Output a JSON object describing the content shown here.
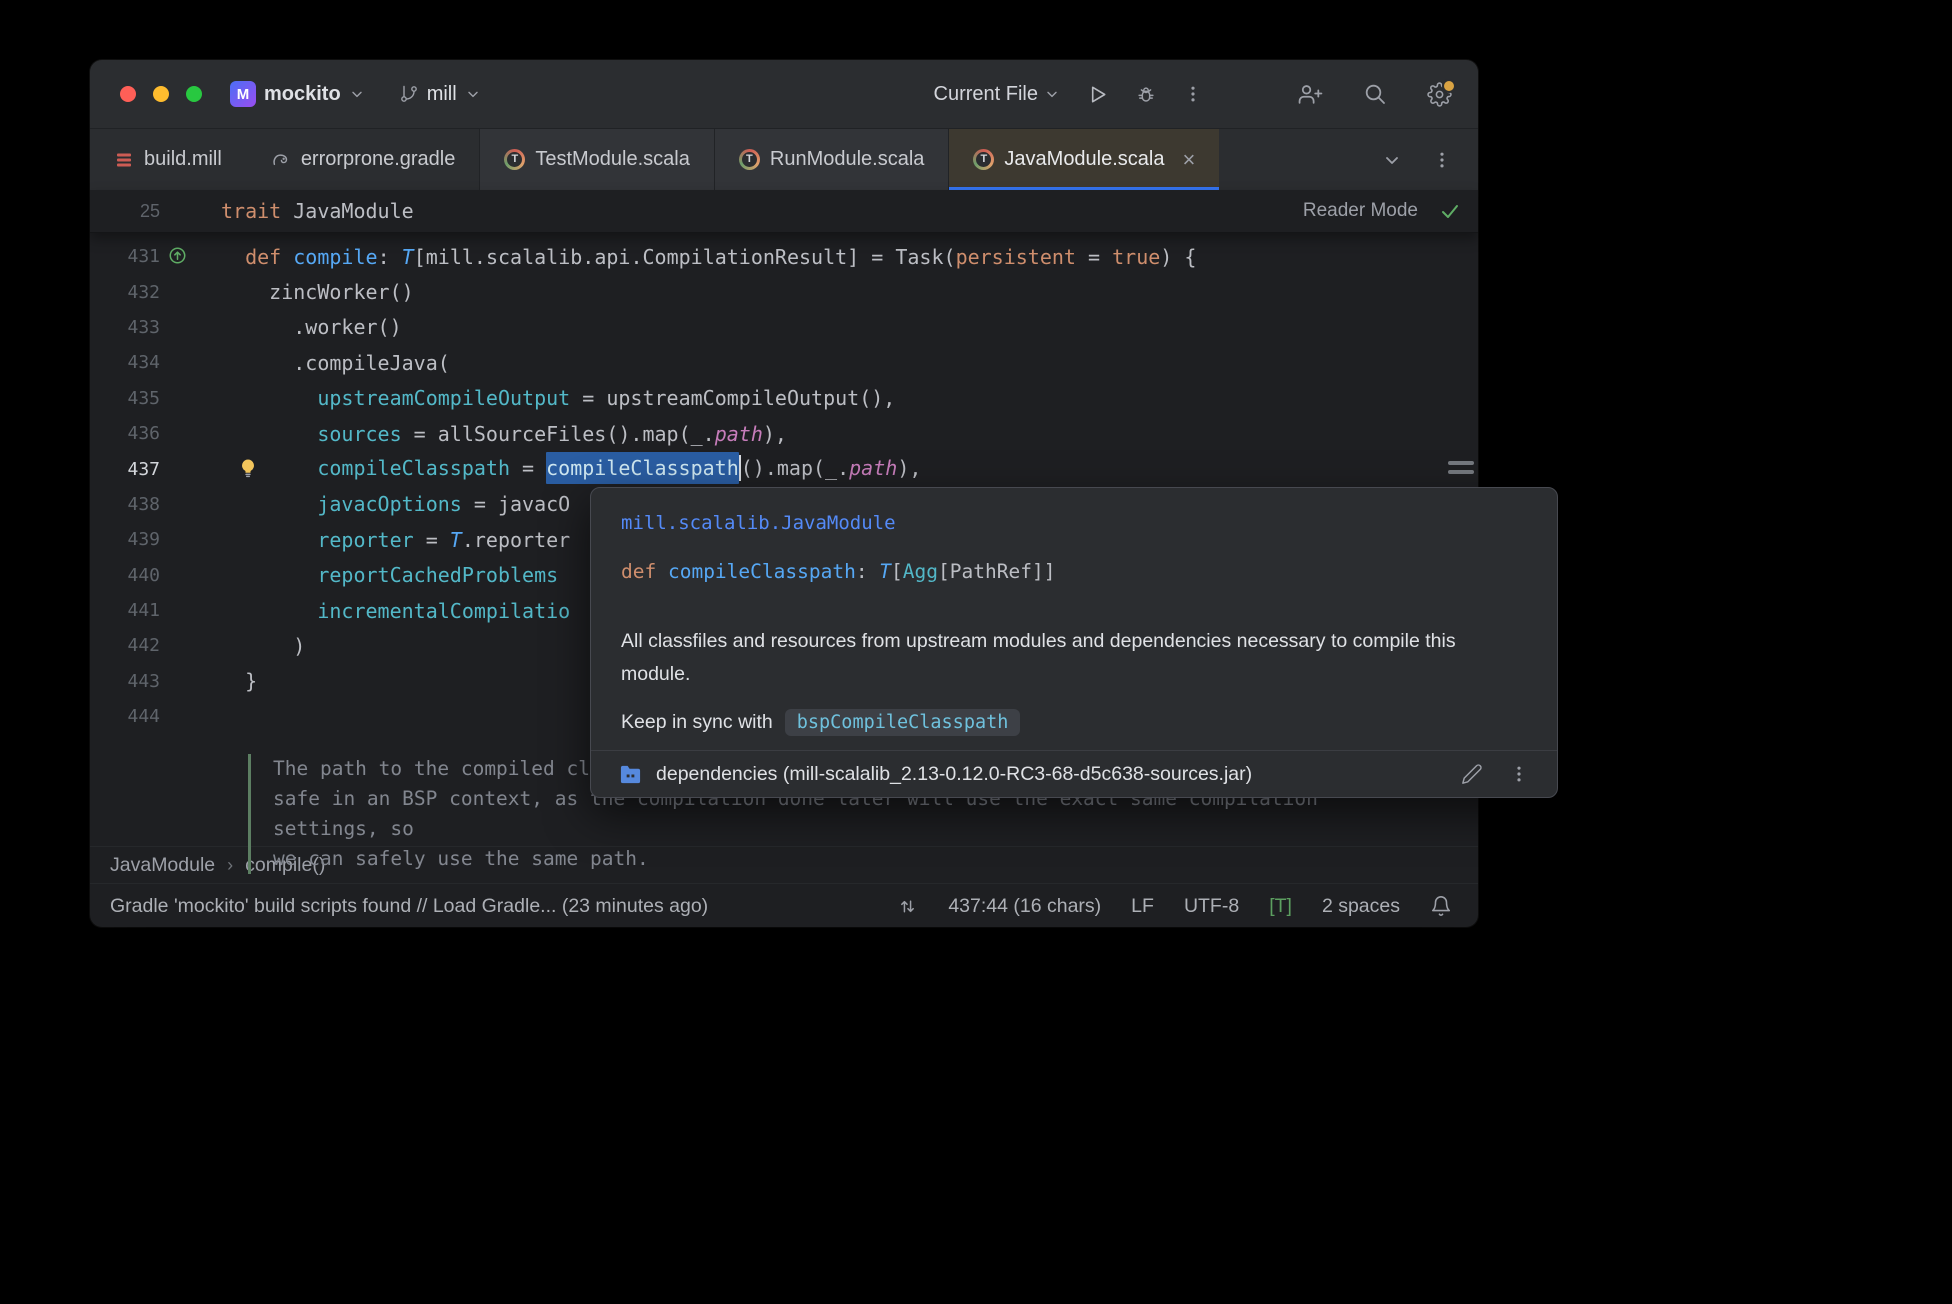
{
  "colors": {
    "accent": "#3574f0",
    "keyword": "#cf8e6d",
    "function": "#56a8f5",
    "parameter": "#53b8c8",
    "field": "#c77dbb",
    "selection": "#2a5da2",
    "link": "#548af7",
    "editor_bg": "#1e1f22",
    "panel_bg": "#2b2d30"
  },
  "titlebar": {
    "project": "mockito",
    "branch": "mill",
    "run_config": "Current File"
  },
  "tabs": [
    {
      "label": "build.mill",
      "icon": "mill-file-icon",
      "group": 1,
      "active": false,
      "closable": false
    },
    {
      "label": "errorprone.gradle",
      "icon": "gradle-icon",
      "group": 1,
      "active": false,
      "closable": false
    },
    {
      "label": "TestModule.scala",
      "icon": "scala-trait-icon",
      "group": 2,
      "active": false,
      "closable": false
    },
    {
      "label": "RunModule.scala",
      "icon": "scala-trait-icon",
      "group": 2,
      "active": false,
      "closable": false
    },
    {
      "label": "JavaModule.scala",
      "icon": "scala-trait-icon",
      "group": 2,
      "active": true,
      "closable": true
    }
  ],
  "sticky": {
    "line_number": "25",
    "segments": [
      {
        "t": "trait ",
        "c": "kw"
      },
      {
        "t": "JavaModule",
        "c": "plain"
      }
    ],
    "reader_mode_label": "Reader Mode"
  },
  "editor": {
    "lines": [
      {
        "n": "431",
        "gutter_icon": "implementing-marker",
        "segments": [
          {
            "t": "  ",
            "c": "plain"
          },
          {
            "t": "def ",
            "c": "kw"
          },
          {
            "t": "compile",
            "c": "fn"
          },
          {
            "t": ": ",
            "c": "plain"
          },
          {
            "t": "T",
            "c": "type"
          },
          {
            "t": "[mill.scalalib.api.CompilationResult] = Task(",
            "c": "plain"
          },
          {
            "t": "persistent",
            "c": "kw"
          },
          {
            "t": " = ",
            "c": "plain"
          },
          {
            "t": "true",
            "c": "kw"
          },
          {
            "t": ") {",
            "c": "plain"
          }
        ]
      },
      {
        "n": "432",
        "segments": [
          {
            "t": "    zincWorker()",
            "c": "plain"
          }
        ]
      },
      {
        "n": "433",
        "segments": [
          {
            "t": "      .worker()",
            "c": "plain"
          }
        ]
      },
      {
        "n": "434",
        "segments": [
          {
            "t": "      .compileJava(",
            "c": "plain"
          }
        ]
      },
      {
        "n": "435",
        "segments": [
          {
            "t": "        ",
            "c": "plain"
          },
          {
            "t": "upstreamCompileOutput",
            "c": "arg"
          },
          {
            "t": " = upstreamCompileOutput(),",
            "c": "plain"
          }
        ]
      },
      {
        "n": "436",
        "segments": [
          {
            "t": "        ",
            "c": "plain"
          },
          {
            "t": "sources",
            "c": "arg"
          },
          {
            "t": " = allSourceFiles().map(_.",
            "c": "plain"
          },
          {
            "t": "path",
            "c": "field"
          },
          {
            "t": "),",
            "c": "plain"
          }
        ]
      },
      {
        "n": "437",
        "bulb": true,
        "current": true,
        "segments": [
          {
            "t": "        ",
            "c": "plain"
          },
          {
            "t": "compileClasspath",
            "c": "arg"
          },
          {
            "t": " = ",
            "c": "plain"
          },
          {
            "t": "compileClasspath",
            "c": "sel"
          },
          {
            "t": "",
            "c": "caret"
          },
          {
            "t": "().map(_.",
            "c": "plain"
          },
          {
            "t": "path",
            "c": "field"
          },
          {
            "t": "),",
            "c": "plain"
          }
        ]
      },
      {
        "n": "438",
        "segments": [
          {
            "t": "        ",
            "c": "plain"
          },
          {
            "t": "javacOptions",
            "c": "arg"
          },
          {
            "t": " = javacO",
            "c": "plain"
          }
        ]
      },
      {
        "n": "439",
        "segments": [
          {
            "t": "        ",
            "c": "plain"
          },
          {
            "t": "reporter",
            "c": "arg"
          },
          {
            "t": " = ",
            "c": "plain"
          },
          {
            "t": "T",
            "c": "type"
          },
          {
            "t": ".reporter",
            "c": "plain"
          }
        ]
      },
      {
        "n": "440",
        "segments": [
          {
            "t": "        ",
            "c": "plain"
          },
          {
            "t": "reportCachedProblems",
            "c": "arg"
          }
        ]
      },
      {
        "n": "441",
        "segments": [
          {
            "t": "        ",
            "c": "plain"
          },
          {
            "t": "incrementalCompilatio",
            "c": "arg"
          }
        ]
      },
      {
        "n": "442",
        "segments": [
          {
            "t": "      )",
            "c": "plain"
          }
        ]
      },
      {
        "n": "443",
        "segments": [
          {
            "t": "  }",
            "c": "plain"
          }
        ]
      },
      {
        "n": "444",
        "segments": []
      }
    ],
    "doc_comment_lines": [
      "The path to the compiled classe",
      "safe in an BSP context, as the compilation done later will use the exact same compilation settings, so",
      "we can safely use the same path."
    ]
  },
  "popup": {
    "link": "mill.scalalib.JavaModule",
    "signature_segments": [
      {
        "t": "def ",
        "c": "kw"
      },
      {
        "t": "compileClasspath",
        "c": "fn"
      },
      {
        "t": ": ",
        "c": "plain"
      },
      {
        "t": "T",
        "c": "type"
      },
      {
        "t": "[",
        "c": "plain"
      },
      {
        "t": "Agg",
        "c": "arg"
      },
      {
        "t": "[PathRef]]",
        "c": "plain"
      }
    ],
    "description": "All classfiles and resources from upstream modules and dependencies necessary to compile this module.",
    "sync_label": "Keep in sync with",
    "sync_chip": "bspCompileClasspath",
    "attachment": "dependencies (mill-scalalib_2.13-0.12.0-RC3-68-d5c638-sources.jar)"
  },
  "breadcrumbs": [
    "JavaModule",
    "compile()"
  ],
  "statusbar": {
    "message": "Gradle 'mockito' build scripts found // Load Gradle... (23 minutes ago)",
    "caret_position": "437:44 (16 chars)",
    "line_separator": "LF",
    "encoding": "UTF-8",
    "type_aware_highlighting": "[T]",
    "indent": "2 spaces"
  }
}
